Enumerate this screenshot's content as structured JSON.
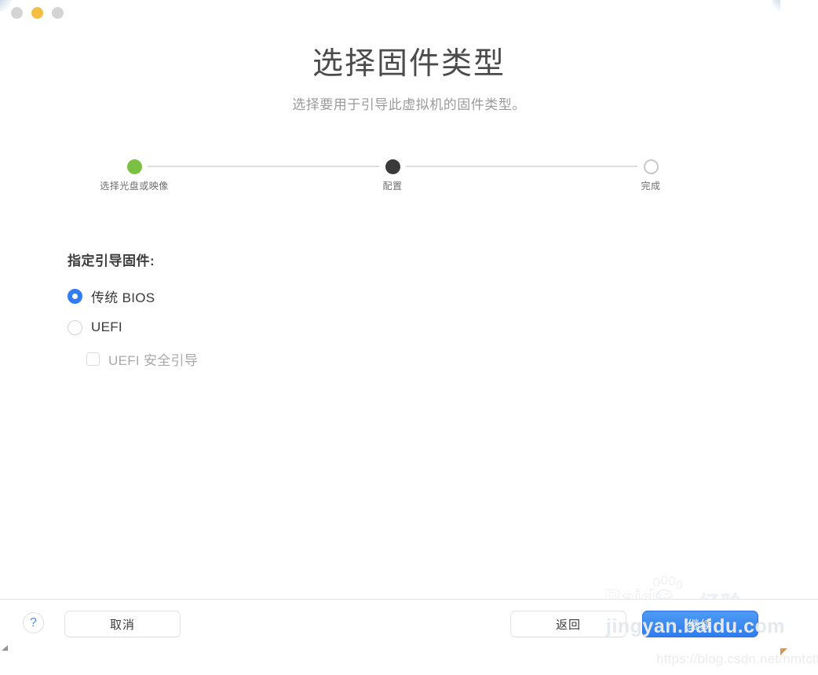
{
  "window": {
    "traffic_lights": [
      {
        "name": "close",
        "color": "#d4d4d4"
      },
      {
        "name": "minimize",
        "color": "#f5be40"
      },
      {
        "name": "zoom",
        "color": "#d4d4d4"
      }
    ]
  },
  "header": {
    "title": "选择固件类型",
    "subtitle": "选择要用于引导此虚拟机的固件类型。"
  },
  "stepper": {
    "steps": [
      {
        "label": "选择光盘或映像",
        "state": "done",
        "color": "#7ac143"
      },
      {
        "label": "配置",
        "state": "current",
        "color": "#3a3a3a"
      },
      {
        "label": "完成",
        "state": "todo",
        "color": "#c8c8c8"
      }
    ]
  },
  "form": {
    "legend": "指定引导固件:",
    "options": [
      {
        "label": "传统 BIOS",
        "type": "radio",
        "checked": true,
        "disabled": false
      },
      {
        "label": "UEFI",
        "type": "radio",
        "checked": false,
        "disabled": false
      },
      {
        "label": "UEFI 安全引导",
        "type": "checkbox",
        "checked": false,
        "disabled": true
      }
    ],
    "accent_color": "#2f7cf6"
  },
  "footer": {
    "help_label": "?",
    "cancel_label": "取消",
    "back_label": "返回",
    "continue_label": "继续",
    "primary_color": "#2f7cf0"
  },
  "watermarks": {
    "baidu_logo": "Baidu",
    "baidu_cn": "经验",
    "site_url": "jingyan.baidu.com",
    "blog_url": "https://blog.csdn.net/nmtcttn"
  }
}
